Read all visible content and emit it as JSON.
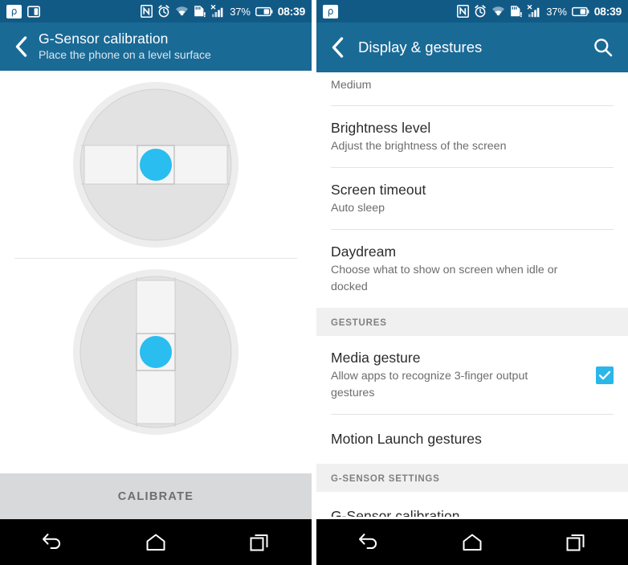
{
  "colors": {
    "statusbar_bg": "#125a86",
    "appbar_bg": "#1a6a96",
    "accent_cyan": "#29bdf0",
    "checkbox_cyan": "#2ab6e8",
    "calibrate_bg": "#d7d9da",
    "navbar_bg": "#000000",
    "section_bg": "#f0f0f0",
    "gauge_face": "#e2e2e2",
    "gauge_rim": "#eaeaea",
    "gauge_window": "#f4f4f4"
  },
  "status_bar": {
    "left_icons": [
      "p-badge-icon",
      "card-switch-icon"
    ],
    "right_icons": [
      "nfc-icon",
      "alarm-clock-icon",
      "wifi-icon",
      "sd-card-alert-icon",
      "signal-bars-no-service-icon"
    ],
    "battery_percent": "37%",
    "battery_icon": "battery-icon",
    "time": "08:39"
  },
  "left_screen": {
    "appbar": {
      "back_icon": "back-chevron-icon",
      "title": "G-Sensor calibration",
      "subtitle": "Place the phone on a level surface"
    },
    "gauges": [
      {
        "name": "horizontal-level-gauge",
        "orientation": "horizontal",
        "bubble_position": "center",
        "bubble_color": "#29bdf0"
      },
      {
        "name": "vertical-level-gauge",
        "orientation": "vertical",
        "bubble_position": "center",
        "bubble_color": "#29bdf0"
      }
    ],
    "calibrate_button": "CALIBRATE"
  },
  "right_screen": {
    "appbar": {
      "back_icon": "back-chevron-icon",
      "title": "Display & gestures",
      "search_icon": "search-icon"
    },
    "items": [
      {
        "type": "partial-row",
        "name": "font-size-row",
        "subtitle": "Medium"
      },
      {
        "type": "row",
        "name": "brightness-level-row",
        "title": "Brightness level",
        "subtitle": "Adjust the brightness of the screen"
      },
      {
        "type": "row",
        "name": "screen-timeout-row",
        "title": "Screen timeout",
        "subtitle": "Auto sleep"
      },
      {
        "type": "row",
        "name": "daydream-row",
        "title": "Daydream",
        "subtitle": "Choose what to show on screen when idle or docked"
      },
      {
        "type": "section",
        "name": "gestures-section-header",
        "title": "GESTURES"
      },
      {
        "type": "row-checkbox",
        "name": "media-gesture-row",
        "title": "Media gesture",
        "subtitle": "Allow apps to recognize 3-finger output gestures",
        "checked": true
      },
      {
        "type": "row",
        "name": "motion-launch-gestures-row",
        "title": "Motion Launch gestures",
        "subtitle": ""
      },
      {
        "type": "section",
        "name": "g-sensor-settings-section-header",
        "title": "G-SENSOR SETTINGS"
      },
      {
        "type": "row",
        "name": "g-sensor-calibration-row",
        "title": "G-Sensor calibration",
        "subtitle": ""
      }
    ]
  },
  "nav_bar": {
    "back": "back-icon",
    "home": "home-icon",
    "recents": "recent-apps-icon"
  }
}
